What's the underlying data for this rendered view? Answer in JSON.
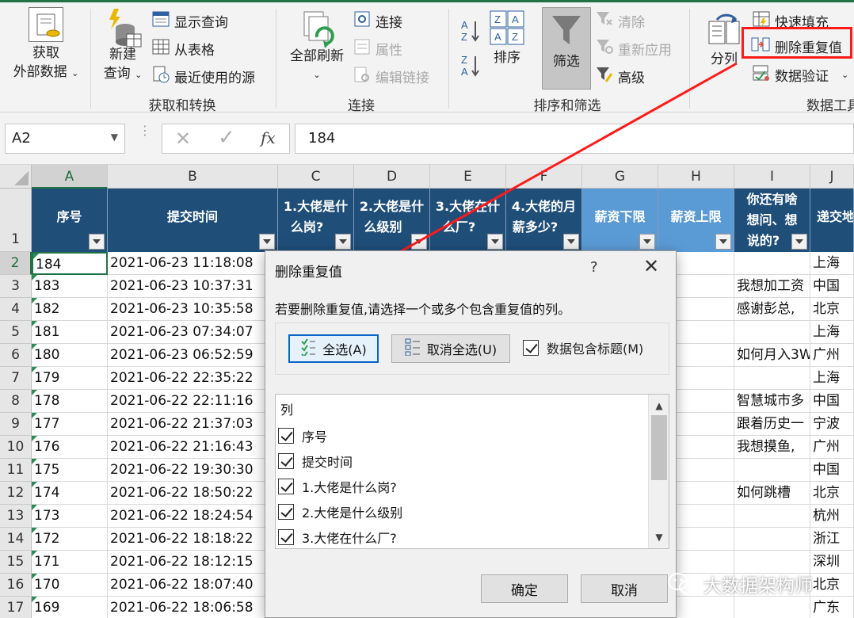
{
  "ribbon": {
    "get_external": {
      "line1": "获取",
      "line2": "外部数据"
    },
    "new_query": {
      "line1": "新建",
      "line2": "查询"
    },
    "show_query": "显示查询",
    "from_table": "从表格",
    "recent_sources": "最近使用的源",
    "group_get_transform": "获取和转换",
    "refresh_all": "全部刷新",
    "connections": "连接",
    "properties": "属性",
    "edit_links": "编辑链接",
    "group_connections": "连接",
    "sort": "排序",
    "filter": "筛选",
    "clear": "清除",
    "reapply": "重新应用",
    "advanced": "高级",
    "group_sort_filter": "排序和筛选",
    "text_to_columns": "分列",
    "flash_fill": "快速填充",
    "remove_duplicates": "删除重复值",
    "data_validation": "数据验证",
    "group_data_tools": "数据工具"
  },
  "formula_bar": {
    "name_box": "A2",
    "fx": "fx",
    "value": "184"
  },
  "grid": {
    "columns": [
      "A",
      "B",
      "C",
      "D",
      "E",
      "F",
      "G",
      "H",
      "I",
      "J"
    ],
    "header_row_num": "1",
    "headers": [
      {
        "line1": "序号",
        "line2": ""
      },
      {
        "line1": "提交时间",
        "line2": ""
      },
      {
        "line1": "1.大佬是什",
        "line2": "么岗?"
      },
      {
        "line1": "2.大佬是什",
        "line2": "么级别"
      },
      {
        "line1": "3.大佬在什",
        "line2": "么厂?"
      },
      {
        "line1": "4.大佬的月",
        "line2": "薪多少?"
      },
      {
        "line1": "薪资下限",
        "line2": ""
      },
      {
        "line1": "薪资上限",
        "line2": ""
      },
      {
        "line1": "你还有啥",
        "line2": "想问、想",
        "line3": "说的?"
      },
      {
        "line1": "递交地",
        "line2": ""
      }
    ],
    "rows": [
      {
        "num": "2",
        "a": "184",
        "b": "2021-06-23 11:18:08",
        "i": "",
        "j": "上海"
      },
      {
        "num": "3",
        "a": "183",
        "b": "2021-06-23 10:37:31",
        "i": "我想加工资",
        "j": "中国"
      },
      {
        "num": "4",
        "a": "182",
        "b": "2021-06-23 10:35:58",
        "i": "感谢彭总,",
        "j": "北京"
      },
      {
        "num": "5",
        "a": "181",
        "b": "2021-06-23 07:34:07",
        "i": "",
        "j": "上海"
      },
      {
        "num": "6",
        "a": "180",
        "b": "2021-06-23 06:52:59",
        "i": "如何月入3W",
        "j": "广州"
      },
      {
        "num": "7",
        "a": "179",
        "b": "2021-06-22 22:35:22",
        "i": "",
        "j": "上海"
      },
      {
        "num": "8",
        "a": "178",
        "b": "2021-06-22 22:11:16",
        "i": "智慧城市多",
        "j": "中国"
      },
      {
        "num": "9",
        "a": "177",
        "b": "2021-06-22 21:37:03",
        "i": "跟着历史一",
        "j": "宁波"
      },
      {
        "num": "10",
        "a": "176",
        "b": "2021-06-22 21:16:43",
        "i": "我想摸鱼,",
        "j": "广州"
      },
      {
        "num": "11",
        "a": "175",
        "b": "2021-06-22 19:30:30",
        "i": "",
        "j": "中国"
      },
      {
        "num": "12",
        "a": "174",
        "b": "2021-06-22 18:50:22",
        "i": "如何跳槽",
        "j": "北京"
      },
      {
        "num": "13",
        "a": "173",
        "b": "2021-06-22 18:24:54",
        "i": "",
        "j": "杭州"
      },
      {
        "num": "14",
        "a": "172",
        "b": "2021-06-22 18:18:22",
        "i": "",
        "j": "浙江"
      },
      {
        "num": "15",
        "a": "171",
        "b": "2021-06-22 18:12:15",
        "i": "",
        "j": "深圳"
      },
      {
        "num": "16",
        "a": "170",
        "b": "2021-06-22 18:07:40",
        "i": "",
        "j": "北京"
      },
      {
        "num": "17",
        "a": "169",
        "b": "2021-06-22 18:06:58",
        "i": "",
        "j": "广东"
      }
    ]
  },
  "dialog": {
    "title": "删除重复值",
    "help": "?",
    "close": "✕",
    "instruction": "若要删除重复值,请选择一个或多个包含重复值的列。",
    "select_all": "全选(A)",
    "unselect_all": "取消全选(U)",
    "has_headers": "数据包含标题(M)",
    "column_header": "列",
    "columns": [
      "序号",
      "提交时间",
      "1.大佬是什么岗?",
      "2.大佬是什么级别",
      "3.大佬在什么厂?"
    ],
    "ok": "确定",
    "cancel": "取消"
  },
  "watermark": "大数据架构师",
  "colors": {
    "accent_green": "#217346",
    "header_dark": "#1f4e79",
    "header_light": "#5b9bd5",
    "annotation_red": "#ff1a1a"
  }
}
